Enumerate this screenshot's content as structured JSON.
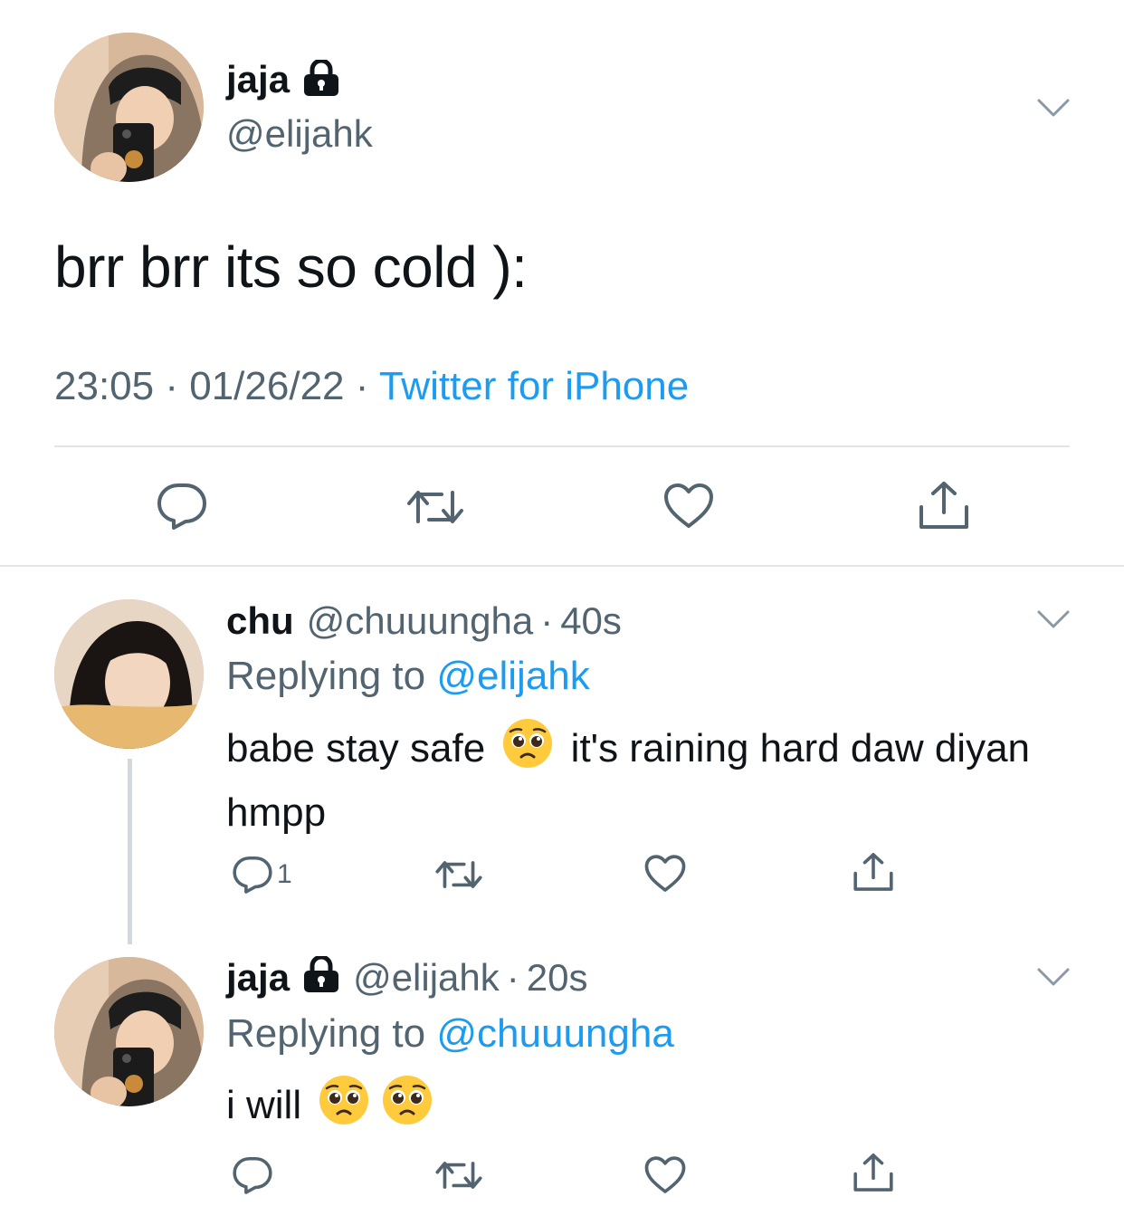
{
  "main_tweet": {
    "display_name": "jaja",
    "handle": "@elijahk",
    "text": "brr brr its so cold ):",
    "time": "23:05",
    "date": "01/26/22",
    "separator": "·",
    "source": "Twitter for iPhone"
  },
  "replies": [
    {
      "display_name": "chu",
      "handle": "@chuuungha",
      "separator": "·",
      "time": "40s",
      "replying_prefix": "Replying to ",
      "replying_to": "@elijahk",
      "text_before_emoji": "babe stay safe",
      "text_after_emoji": "it's raining hard daw diyan hmpp",
      "reply_count": "1"
    },
    {
      "display_name": "jaja",
      "handle": "@elijahk",
      "separator": "·",
      "time": "20s",
      "replying_prefix": "Replying to ",
      "replying_to": "@chuuungha",
      "text": "i will"
    }
  ],
  "colors": {
    "text": "#0f1419",
    "secondary": "#536471",
    "link": "#1d9bf0",
    "divider": "#e1e5e8",
    "thread_line": "#cfd9de"
  },
  "icons": [
    "lock-icon",
    "chevron-down-icon",
    "reply-icon",
    "retweet-icon",
    "like-icon",
    "share-icon",
    "pleading-face-emoji"
  ]
}
